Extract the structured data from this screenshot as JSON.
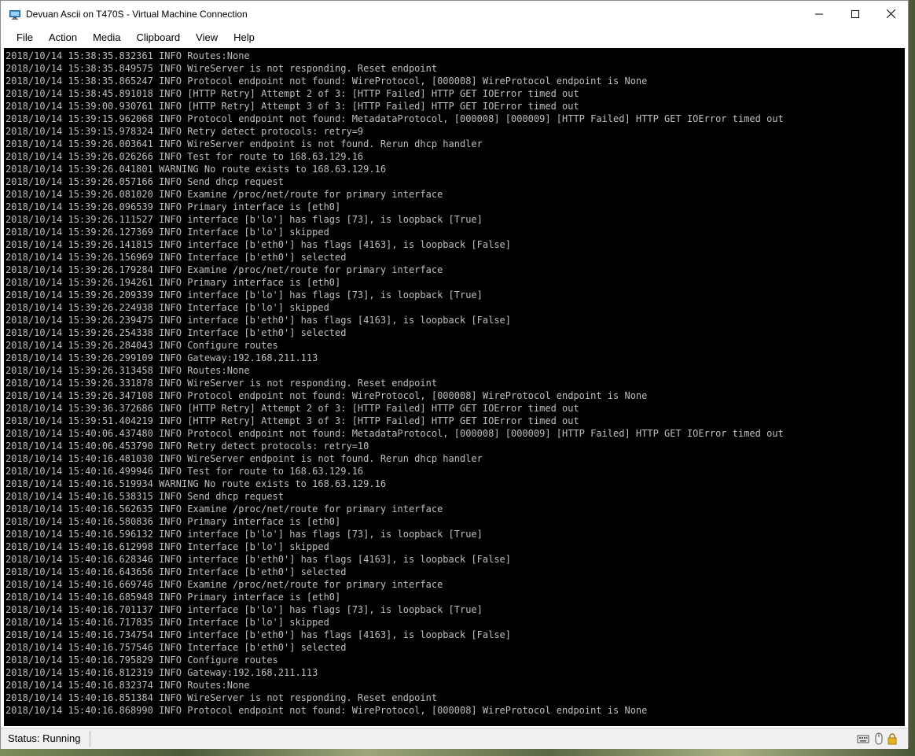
{
  "window": {
    "title": "Devuan Ascii on T470S - Virtual Machine Connection",
    "app_icon": "hyper-v-monitor-icon",
    "controls": [
      "minimize-icon",
      "maximize-icon",
      "close-icon"
    ]
  },
  "menu": {
    "items": [
      {
        "label": "File"
      },
      {
        "label": "Action"
      },
      {
        "label": "Media"
      },
      {
        "label": "Clipboard"
      },
      {
        "label": "View"
      },
      {
        "label": "Help"
      }
    ]
  },
  "console": {
    "text_color": "#bfbfbf",
    "background": "#000000",
    "lines": [
      "2018/10/14 15:38:35.832361 INFO Routes:None",
      "2018/10/14 15:38:35.849575 INFO WireServer is not responding. Reset endpoint",
      "2018/10/14 15:38:35.865247 INFO Protocol endpoint not found: WireProtocol, [000008] WireProtocol endpoint is None",
      "2018/10/14 15:38:45.891018 INFO [HTTP Retry] Attempt 2 of 3: [HTTP Failed] HTTP GET IOError timed out",
      "2018/10/14 15:39:00.930761 INFO [HTTP Retry] Attempt 3 of 3: [HTTP Failed] HTTP GET IOError timed out",
      "2018/10/14 15:39:15.962068 INFO Protocol endpoint not found: MetadataProtocol, [000008] [000009] [HTTP Failed] HTTP GET IOError timed out",
      "2018/10/14 15:39:15.978324 INFO Retry detect protocols: retry=9",
      "2018/10/14 15:39:26.003641 INFO WireServer endpoint is not found. Rerun dhcp handler",
      "2018/10/14 15:39:26.026266 INFO Test for route to 168.63.129.16",
      "2018/10/14 15:39:26.041801 WARNING No route exists to 168.63.129.16",
      "2018/10/14 15:39:26.057166 INFO Send dhcp request",
      "2018/10/14 15:39:26.081020 INFO Examine /proc/net/route for primary interface",
      "2018/10/14 15:39:26.096539 INFO Primary interface is [eth0]",
      "2018/10/14 15:39:26.111527 INFO interface [b'lo'] has flags [73], is loopback [True]",
      "2018/10/14 15:39:26.127369 INFO Interface [b'lo'] skipped",
      "2018/10/14 15:39:26.141815 INFO interface [b'eth0'] has flags [4163], is loopback [False]",
      "2018/10/14 15:39:26.156969 INFO Interface [b'eth0'] selected",
      "2018/10/14 15:39:26.179284 INFO Examine /proc/net/route for primary interface",
      "2018/10/14 15:39:26.194261 INFO Primary interface is [eth0]",
      "2018/10/14 15:39:26.209339 INFO interface [b'lo'] has flags [73], is loopback [True]",
      "2018/10/14 15:39:26.224938 INFO Interface [b'lo'] skipped",
      "2018/10/14 15:39:26.239475 INFO interface [b'eth0'] has flags [4163], is loopback [False]",
      "2018/10/14 15:39:26.254338 INFO Interface [b'eth0'] selected",
      "2018/10/14 15:39:26.284043 INFO Configure routes",
      "2018/10/14 15:39:26.299109 INFO Gateway:192.168.211.113",
      "2018/10/14 15:39:26.313458 INFO Routes:None",
      "2018/10/14 15:39:26.331878 INFO WireServer is not responding. Reset endpoint",
      "2018/10/14 15:39:26.347108 INFO Protocol endpoint not found: WireProtocol, [000008] WireProtocol endpoint is None",
      "2018/10/14 15:39:36.372686 INFO [HTTP Retry] Attempt 2 of 3: [HTTP Failed] HTTP GET IOError timed out",
      "2018/10/14 15:39:51.404219 INFO [HTTP Retry] Attempt 3 of 3: [HTTP Failed] HTTP GET IOError timed out",
      "2018/10/14 15:40:06.437480 INFO Protocol endpoint not found: MetadataProtocol, [000008] [000009] [HTTP Failed] HTTP GET IOError timed out",
      "2018/10/14 15:40:06.453790 INFO Retry detect protocols: retry=10",
      "2018/10/14 15:40:16.481030 INFO WireServer endpoint is not found. Rerun dhcp handler",
      "2018/10/14 15:40:16.499946 INFO Test for route to 168.63.129.16",
      "2018/10/14 15:40:16.519934 WARNING No route exists to 168.63.129.16",
      "2018/10/14 15:40:16.538315 INFO Send dhcp request",
      "2018/10/14 15:40:16.562635 INFO Examine /proc/net/route for primary interface",
      "2018/10/14 15:40:16.580836 INFO Primary interface is [eth0]",
      "2018/10/14 15:40:16.596132 INFO interface [b'lo'] has flags [73], is loopback [True]",
      "2018/10/14 15:40:16.612998 INFO Interface [b'lo'] skipped",
      "2018/10/14 15:40:16.628346 INFO interface [b'eth0'] has flags [4163], is loopback [False]",
      "2018/10/14 15:40:16.643656 INFO Interface [b'eth0'] selected",
      "2018/10/14 15:40:16.669746 INFO Examine /proc/net/route for primary interface",
      "2018/10/14 15:40:16.685948 INFO Primary interface is [eth0]",
      "2018/10/14 15:40:16.701137 INFO interface [b'lo'] has flags [73], is loopback [True]",
      "2018/10/14 15:40:16.717835 INFO Interface [b'lo'] skipped",
      "2018/10/14 15:40:16.734754 INFO interface [b'eth0'] has flags [4163], is loopback [False]",
      "2018/10/14 15:40:16.757546 INFO Interface [b'eth0'] selected",
      "2018/10/14 15:40:16.795829 INFO Configure routes",
      "2018/10/14 15:40:16.812319 INFO Gateway:192.168.211.113",
      "2018/10/14 15:40:16.832374 INFO Routes:None",
      "2018/10/14 15:40:16.851384 INFO WireServer is not responding. Reset endpoint",
      "2018/10/14 15:40:16.868990 INFO Protocol endpoint not found: WireProtocol, [000008] WireProtocol endpoint is None"
    ]
  },
  "status": {
    "text": "Status: Running",
    "icons": [
      "keyboard-icon",
      "mouse-icon",
      "lock-icon"
    ]
  }
}
